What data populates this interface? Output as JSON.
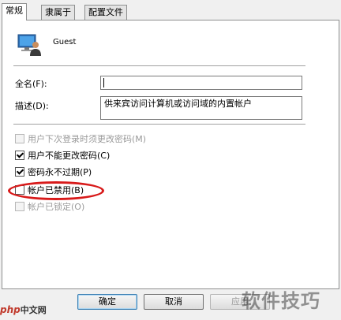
{
  "tabs": [
    {
      "label": "常规",
      "active": true
    },
    {
      "label": "隶属于",
      "active": false
    },
    {
      "label": "配置文件",
      "active": false
    }
  ],
  "user": {
    "name": "Guest",
    "icon": "user-monitor-icon"
  },
  "fields": {
    "full_name_label": "全名(F):",
    "full_name_value": "",
    "description_label": "描述(D):",
    "description_value": "供来宾访问计算机或访问域的内置帐户"
  },
  "checks": [
    {
      "label": "用户下次登录时须更改密码(M)",
      "checked": false,
      "disabled": true
    },
    {
      "label": "用户不能更改密码(C)",
      "checked": true,
      "disabled": false
    },
    {
      "label": "密码永不过期(P)",
      "checked": true,
      "disabled": false
    },
    {
      "label": "帐户已禁用(B)",
      "checked": false,
      "disabled": false
    },
    {
      "label": "帐户已锁定(O)",
      "checked": false,
      "disabled": true
    }
  ],
  "buttons": {
    "ok": "确定",
    "cancel": "取消",
    "apply": "应用"
  },
  "overlay": {
    "logo_php": "php",
    "logo_cn": "中文网",
    "watermark": "软件技巧",
    "highlight_color": "#d81a1a"
  }
}
